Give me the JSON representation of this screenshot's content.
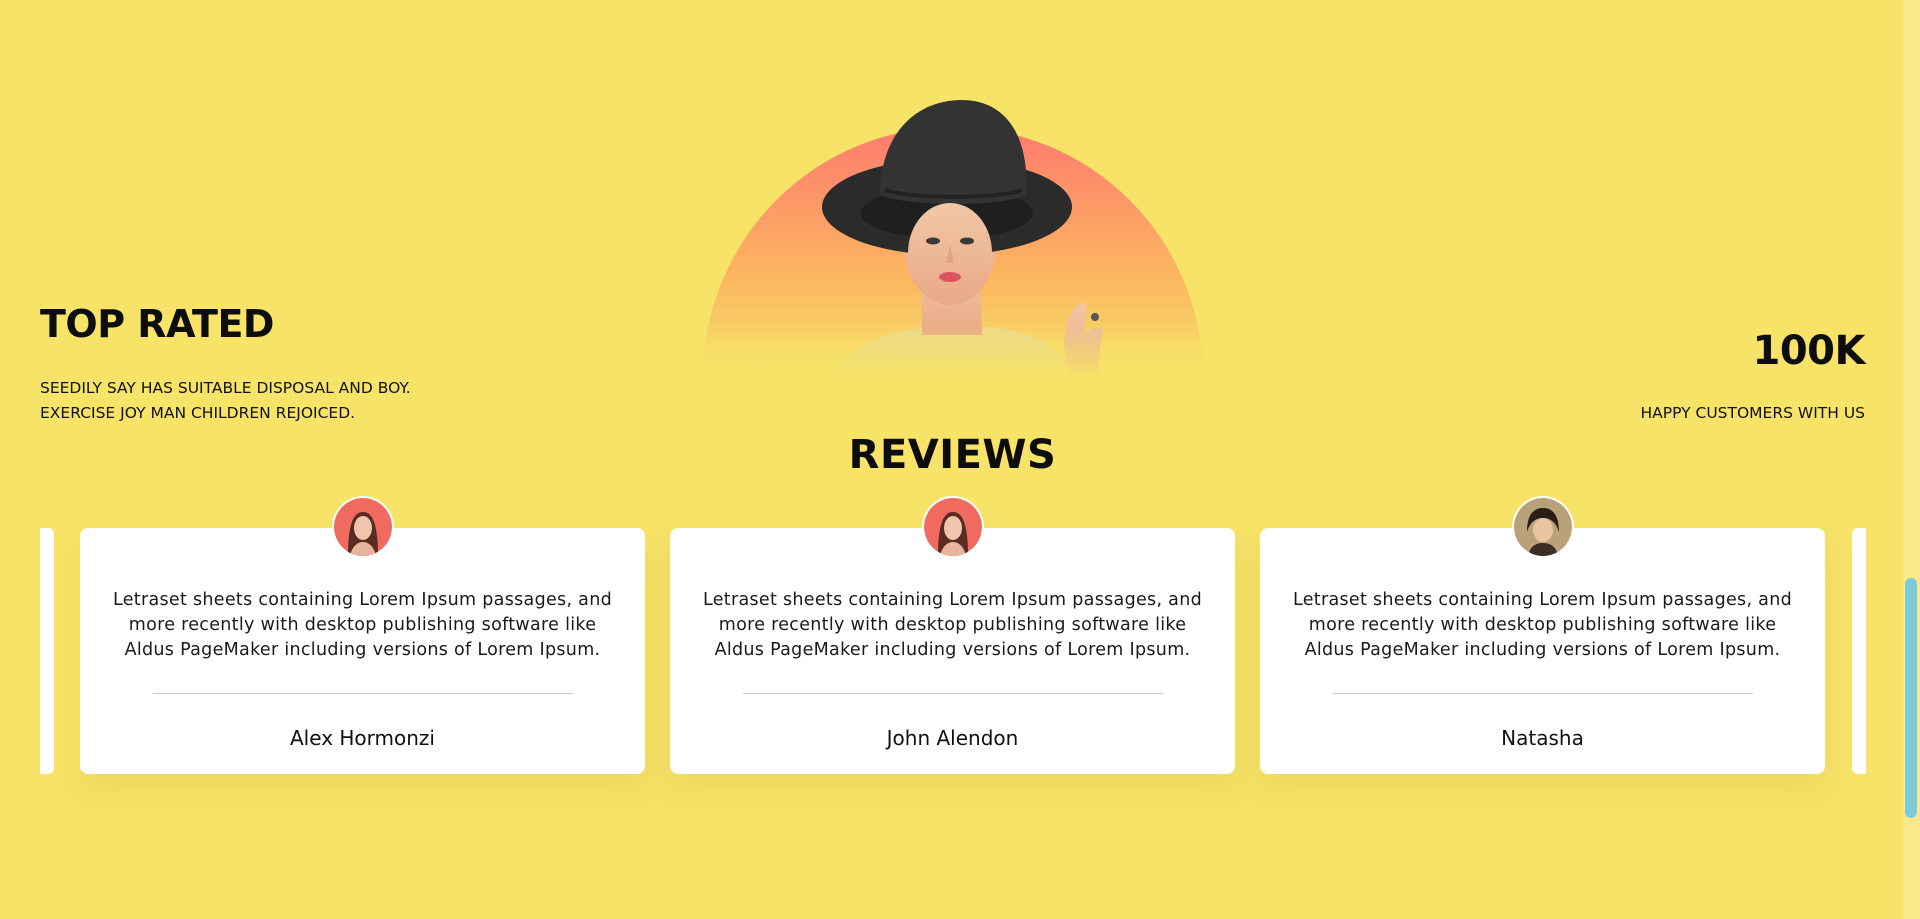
{
  "hero": {
    "title": "TOP RATED",
    "description": "SEEDILY SAY HAS SUITABLE DISPOSAL AND BOY. EXERCISE JOY MAN CHILDREN REJOICED.",
    "stat_value": "100K",
    "stat_caption": "HAPPY CUSTOMERS WITH US"
  },
  "reviews": {
    "title": "REVIEWS",
    "items": [
      {
        "quote": "Letraset sheets containing Lorem Ipsum passages, and more recently with desktop publishing software like Aldus PageMaker including versions of Lorem Ipsum.",
        "name": "Alex Hormonzi"
      },
      {
        "quote": "Letraset sheets containing Lorem Ipsum passages, and more recently with desktop publishing software like Aldus PageMaker including versions of Lorem Ipsum.",
        "name": "John Alendon"
      },
      {
        "quote": "Letraset sheets containing Lorem Ipsum passages, and more recently with desktop publishing software like Aldus PageMaker including versions of Lorem Ipsum.",
        "name": "Natasha"
      }
    ]
  },
  "colors": {
    "background": "#f7e368",
    "card": "#ffffff",
    "scrollbar_thumb": "#7fc9dd",
    "hero_gradient_top": "#ff7a6e",
    "hero_gradient_bottom": "#f7e368"
  }
}
